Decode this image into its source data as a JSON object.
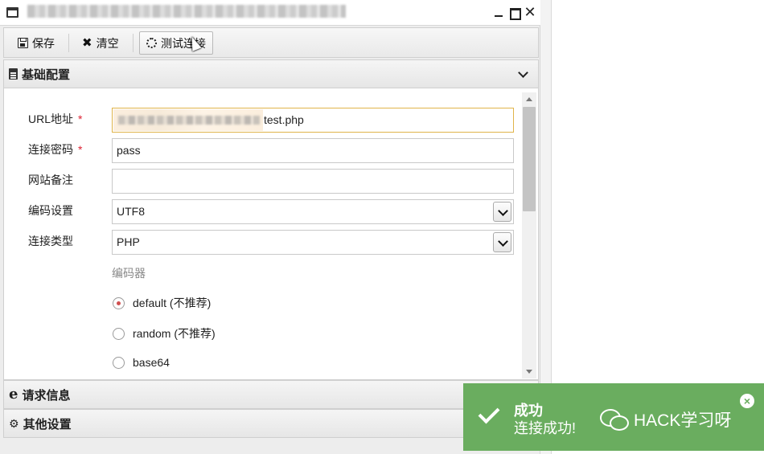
{
  "window": {
    "title": "",
    "icons": {
      "app": "window-icon",
      "minimize": "minimize-icon",
      "maximize": "maximize-icon",
      "close": "close-icon"
    },
    "close_glyph": "✕"
  },
  "toolbar": {
    "save_label": "保存",
    "clear_label": "清空",
    "test_label": "测试连接",
    "icons": {
      "save": "save-icon",
      "clear": "clear-icon",
      "test": "spinner-icon"
    },
    "clear_glyph": "✖"
  },
  "sections": {
    "basic": "基础配置",
    "request": "请求信息",
    "other": "其他设置",
    "icons": {
      "basic": "document-icon",
      "request": "ie-icon",
      "other": "gears-icon"
    },
    "request_glyph": "e",
    "other_glyph": "⚙"
  },
  "form": {
    "url": {
      "label": "URL地址",
      "required": "*",
      "value_visible": "test.php"
    },
    "password": {
      "label": "连接密码",
      "required": "*",
      "value": "pass"
    },
    "note": {
      "label": "网站备注",
      "value": ""
    },
    "encoding": {
      "label": "编码设置",
      "value": "UTF8"
    },
    "type": {
      "label": "连接类型",
      "value": "PHP"
    },
    "encoder": {
      "title": "编码器",
      "options": [
        {
          "label": "default (不推荐)",
          "checked": true
        },
        {
          "label": "random (不推荐)",
          "checked": false
        },
        {
          "label": "base64",
          "checked": false
        }
      ]
    }
  },
  "toast": {
    "title": "成功",
    "message": "连接成功!",
    "close_glyph": "×",
    "icons": {
      "status": "check-icon",
      "close": "close-circle-icon"
    }
  },
  "watermark": {
    "text": "HACK学习呀",
    "icon": "wechat-icon"
  },
  "colors": {
    "toast_bg": "#6aad5f",
    "required": "#dd2233",
    "focus_border": "#e0b44a"
  }
}
